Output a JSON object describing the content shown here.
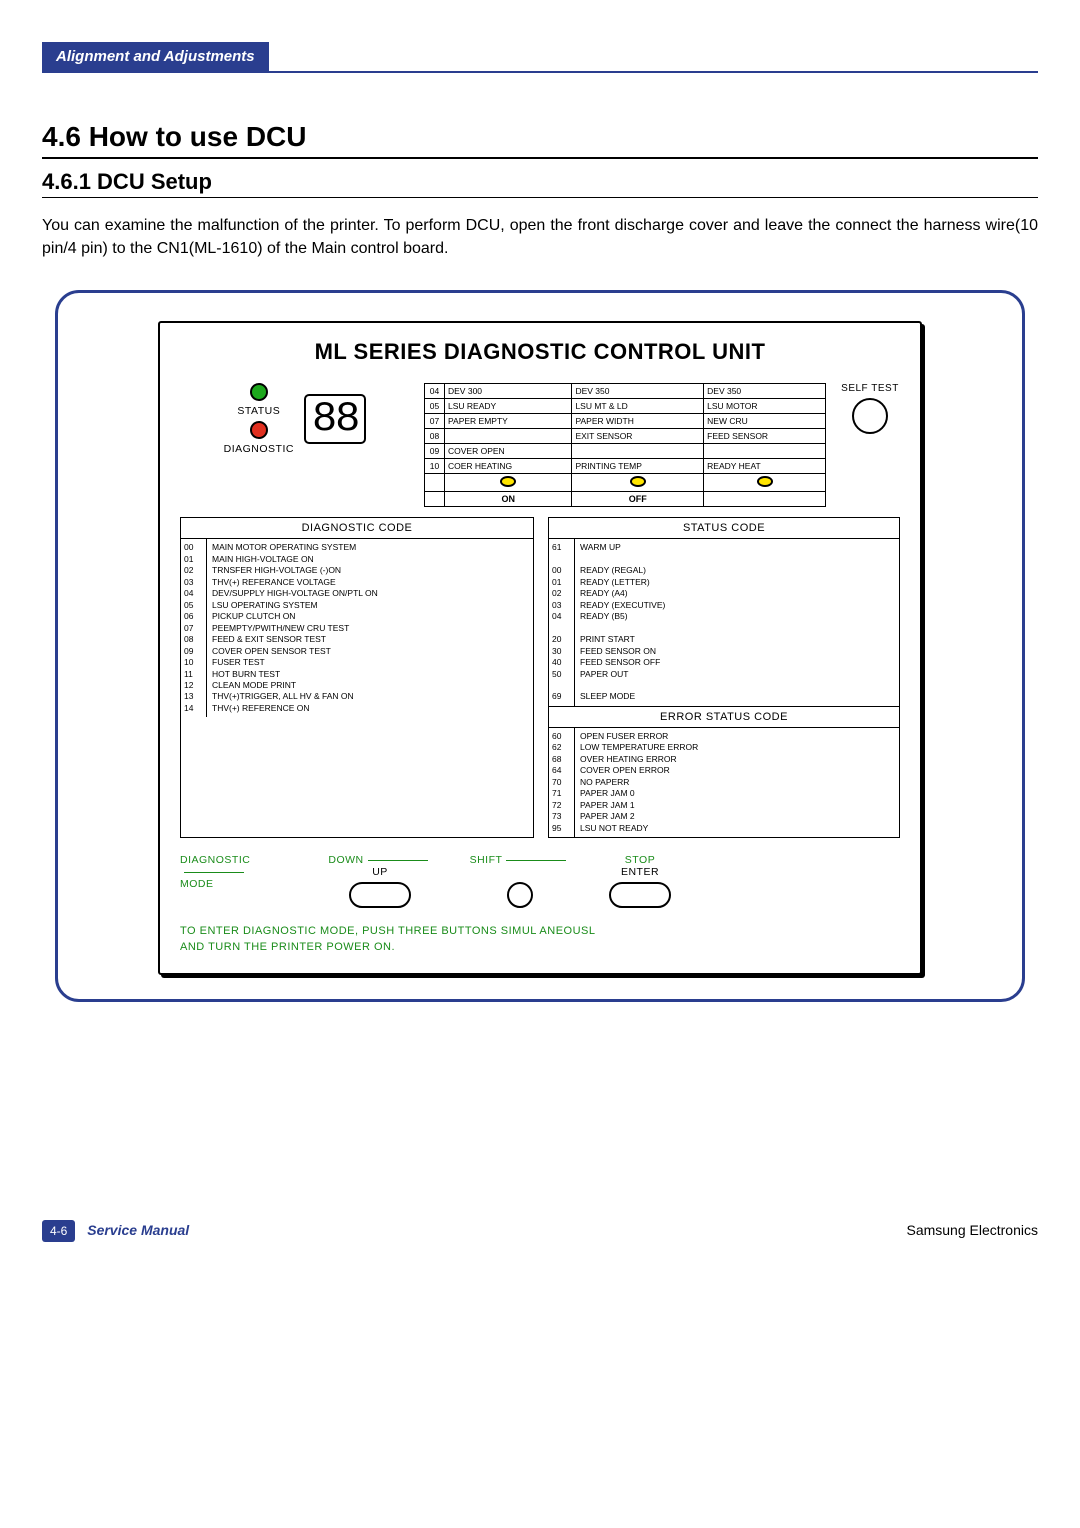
{
  "header_tab": "Alignment and Adjustments",
  "h1": "4.6  How to use DCU",
  "h2": "4.6.1  DCU Setup",
  "body": "You can examine the malfunction of the printer. To perform DCU, open the front discharge cover and leave the connect the harness wire(10 pin/4 pin) to the CN1(ML-1610) of the Main control board.",
  "panel_title": "ML SERIES DIAGNOSTIC CONTROL UNIT",
  "status_label": "STATUS",
  "diagnostic_label": "DIAGNOSTIC",
  "display_value": "88",
  "led_rows": [
    {
      "n": "04",
      "c1": "DEV 300",
      "c2": "DEV 350",
      "c3": "DEV 350"
    },
    {
      "n": "05",
      "c1": "LSU READY",
      "c2": "LSU MT & LD",
      "c3": "LSU MOTOR"
    },
    {
      "n": "07",
      "c1": "PAPER EMPTY",
      "c2": "PAPER WIDTH",
      "c3": "NEW CRU"
    },
    {
      "n": "08",
      "c1": "",
      "c2": "EXIT SENSOR",
      "c3": "FEED SENSOR"
    },
    {
      "n": "09",
      "c1": "COVER OPEN",
      "c2": "",
      "c3": ""
    },
    {
      "n": "10",
      "c1": "COER HEATING",
      "c2": "PRINTING TEMP",
      "c3": "READY HEAT"
    }
  ],
  "on_label": "ON",
  "off_label": "OFF",
  "self_test": "SELF TEST",
  "diag_title": "DIAGNOSTIC CODE",
  "diag_codes": [
    {
      "n": "00",
      "d": "MAIN MOTOR OPERATING SYSTEM"
    },
    {
      "n": "01",
      "d": "MAIN HIGH-VOLTAGE ON"
    },
    {
      "n": "02",
      "d": "TRNSFER HIGH-VOLTAGE (-)ON"
    },
    {
      "n": "03",
      "d": "THV(+) REFERANCE VOLTAGE"
    },
    {
      "n": "04",
      "d": "DEV/SUPPLY HIGH-VOLTAGE ON/PTL ON"
    },
    {
      "n": "05",
      "d": "LSU OPERATING SYSTEM"
    },
    {
      "n": "06",
      "d": "PICKUP CLUTCH ON"
    },
    {
      "n": "07",
      "d": "PEEMPTY/PWITH/NEW CRU TEST"
    },
    {
      "n": "08",
      "d": "FEED & EXIT SENSOR TEST"
    },
    {
      "n": "09",
      "d": "COVER OPEN SENSOR TEST"
    },
    {
      "n": "10",
      "d": "FUSER TEST"
    },
    {
      "n": "11",
      "d": "HOT BURN TEST"
    },
    {
      "n": "12",
      "d": "CLEAN MODE PRINT"
    },
    {
      "n": "13",
      "d": "THV(+)TRIGGER, ALL HV & FAN ON"
    },
    {
      "n": "14",
      "d": "THV(+) REFERENCE ON"
    }
  ],
  "status_title": "STATUS CODE",
  "status_codes": [
    {
      "n": "61",
      "d": "WARM UP"
    },
    {
      "n": "",
      "d": ""
    },
    {
      "n": "00",
      "d": "READY (REGAL)"
    },
    {
      "n": "01",
      "d": "READY (LETTER)"
    },
    {
      "n": "02",
      "d": "READY (A4)"
    },
    {
      "n": "03",
      "d": "READY (EXECUTIVE)"
    },
    {
      "n": "04",
      "d": "READY (B5)"
    },
    {
      "n": "",
      "d": ""
    },
    {
      "n": "20",
      "d": "PRINT START"
    },
    {
      "n": "30",
      "d": "FEED SENSOR ON"
    },
    {
      "n": "40",
      "d": "FEED SENSOR OFF"
    },
    {
      "n": "50",
      "d": "PAPER OUT"
    },
    {
      "n": "",
      "d": ""
    },
    {
      "n": "69",
      "d": "SLEEP MODE"
    }
  ],
  "error_title": "ERROR STATUS CODE",
  "error_codes": [
    {
      "n": "60",
      "d": "OPEN FUSER ERROR"
    },
    {
      "n": "62",
      "d": "LOW TEMPERATURE ERROR"
    },
    {
      "n": "68",
      "d": "OVER HEATING ERROR"
    },
    {
      "n": "64",
      "d": "COVER OPEN ERROR"
    },
    {
      "n": "70",
      "d": "NO PAPERR"
    },
    {
      "n": "71",
      "d": "PAPER JAM 0"
    },
    {
      "n": "72",
      "d": "PAPER JAM 1"
    },
    {
      "n": "73",
      "d": "PAPER JAM 2"
    },
    {
      "n": "95",
      "d": "LSU NOT  READY"
    }
  ],
  "btn_diag_mode": "DIAGNOSTIC",
  "btn_mode": "MODE",
  "btn_down": "DOWN",
  "btn_up": "UP",
  "btn_shift": "SHIFT",
  "btn_stop": "STOP",
  "btn_enter": "ENTER",
  "instruction1": "TO ENTER DIAGNOSTIC MODE, PUSH THREE BUTTONS SIMUL  ANEOUSL",
  "instruction2": "AND TURN THE PRINTER POWER ON.",
  "page_num": "4-6",
  "svc_manual": "Service Manual",
  "company": "Samsung Electronics"
}
